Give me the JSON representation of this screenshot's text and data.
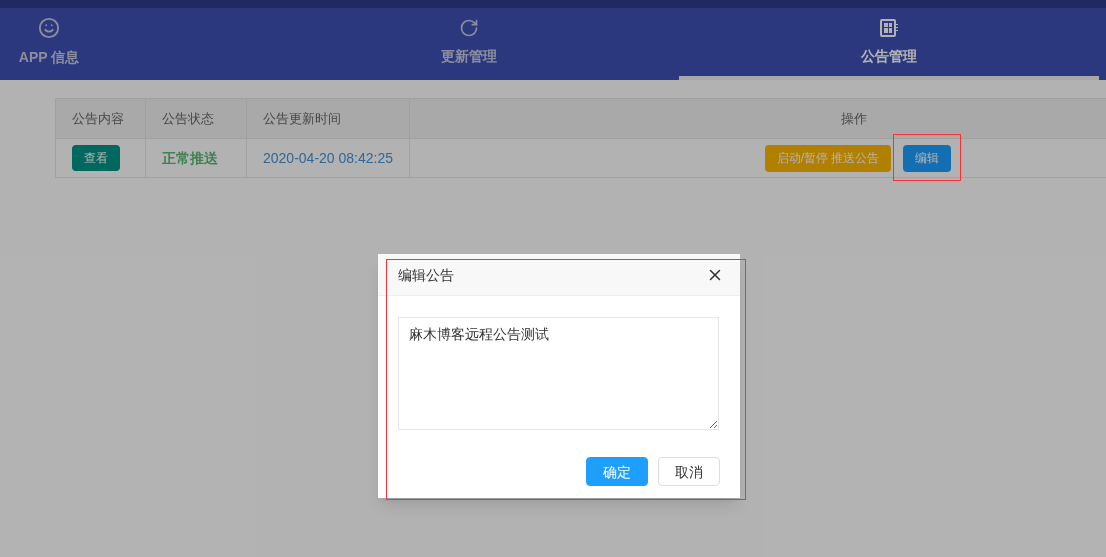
{
  "tabs": [
    {
      "label": "APP 信息",
      "selected": false
    },
    {
      "label": "更新管理",
      "selected": false
    },
    {
      "label": "公告管理",
      "selected": true
    }
  ],
  "table": {
    "columns": [
      "公告内容",
      "公告状态",
      "公告更新时间",
      "操作"
    ],
    "rows": [
      {
        "view_button": "查看",
        "status": "正常推送",
        "updated": "2020-04-20 08:42:25",
        "actions": [
          {
            "label": "启动/暂停 推送公告",
            "kind": "warm"
          },
          {
            "label": "编辑",
            "kind": "normal"
          }
        ]
      }
    ]
  },
  "dialog": {
    "title": "编辑公告",
    "textarea": {
      "value": "麻木博客远程公告测试"
    },
    "buttons": [
      {
        "label": "确定",
        "kind": "primary"
      },
      {
        "label": "取消",
        "kind": "default"
      }
    ]
  }
}
